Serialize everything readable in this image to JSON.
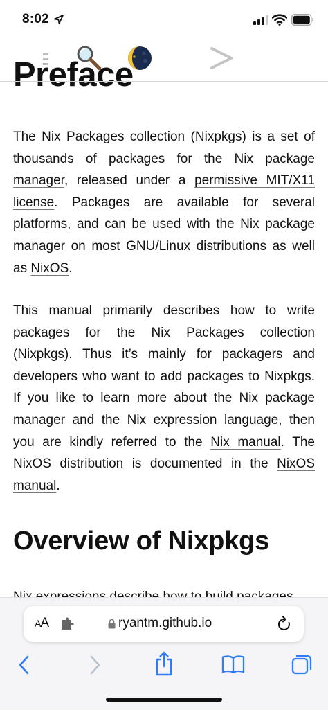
{
  "status_bar": {
    "time": "8:02"
  },
  "icons": {
    "location": "location-arrow-icon",
    "signal": "cellular-signal-icon",
    "wifi": "wifi-icon",
    "battery": "battery-icon",
    "menu": "menu-icon",
    "search": "search-icon",
    "theme": "moon-theme-icon",
    "next": "chevron-right-icon"
  },
  "content": {
    "title": "Preface",
    "p1": {
      "t1": "The Nix Packages collection (Nixpkgs) is a set of thousands of packages for the ",
      "link1": "Nix package manager",
      "t2": ", released under a ",
      "link2": "permissive MIT/X11 license",
      "t3": ". Packages are available for several platforms, and can be used with the Nix package manager on most GNU/Linux distributions as well as ",
      "link3": "NixOS",
      "t4": "."
    },
    "p2": {
      "t1": "This manual primarily describes how to write packages for the Nix Packages collection (Nixpkgs). Thus it’s mainly for packagers and developers who want to add packages to Nixpkgs. If you like to learn more about the Nix package manager and the Nix expression language, then you are kindly referred to the ",
      "link1": "Nix manual",
      "t2": ". The NixOS distribution is documented in the ",
      "link2": "NixOS manual",
      "t3": "."
    },
    "heading2": "Overview of Nixpkgs",
    "p3_partial": "Nix expressions describe how to build packages"
  },
  "browser": {
    "aa_label_small": "A",
    "aa_label_large": "A",
    "url": "ryantm.github.io"
  }
}
